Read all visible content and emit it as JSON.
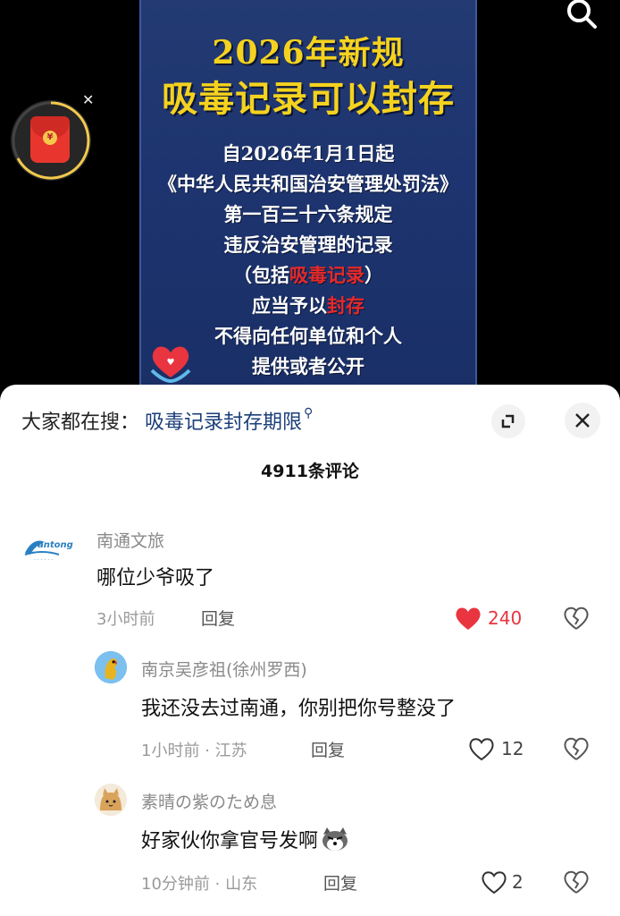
{
  "video": {
    "title_line1": "2026年新规",
    "title_line2": "吸毒记录可以封存",
    "lines": [
      {
        "parts": [
          {
            "text": "自2026年1月1日起",
            "red": false
          }
        ]
      },
      {
        "parts": [
          {
            "text": "《中华人民共和国治安管理处罚法》",
            "red": false
          }
        ]
      },
      {
        "parts": [
          {
            "text": "第一百三十六条规定",
            "red": false
          }
        ]
      },
      {
        "parts": [
          {
            "text": "违反治安管理的记录",
            "red": false
          }
        ]
      },
      {
        "parts": [
          {
            "text": "（包括",
            "red": false
          },
          {
            "text": "吸毒记录",
            "red": true
          },
          {
            "text": "）",
            "red": false
          }
        ]
      },
      {
        "parts": [
          {
            "text": "应当予以",
            "red": false
          },
          {
            "text": "封存",
            "red": true
          }
        ]
      },
      {
        "parts": [
          {
            "text": "不得向任何单位和个人",
            "red": false
          }
        ]
      },
      {
        "parts": [
          {
            "text": "提供或者公开",
            "red": false
          }
        ]
      }
    ],
    "icons": {
      "search": "search-icon",
      "red_packet": "red-packet-icon",
      "close": "close-icon",
      "logo": "heart-hands-logo"
    },
    "colors": {
      "title": "#f5d21e",
      "highlight": "#e52a2a",
      "poster_bg": "#1d3470"
    }
  },
  "sheet": {
    "search_prefix": "大家都在搜：",
    "search_keyword": "吸毒记录封存期限",
    "comment_count": "4911条评论",
    "expand_icon": "expand-icon",
    "close_icon": "close-icon"
  },
  "comments": [
    {
      "user": "南通文旅",
      "text": "哪位少爷吸了",
      "time": "3小时前",
      "location": "",
      "reply": "回复",
      "likes": "240",
      "liked": true,
      "avatar": "nantong-logo-avatar"
    },
    {
      "user": "南京吴彦祖(徐州罗西)",
      "text": "我还没去过南通，你别把你号整没了",
      "time": "1小时前",
      "location": "江苏",
      "reply": "回复",
      "likes": "12",
      "liked": false,
      "avatar": "parrot-avatar"
    },
    {
      "user": "素晴の紫のため息",
      "text": "好家伙你拿官号发啊",
      "time": "10分钟前",
      "location": "山东",
      "reply": "回复",
      "likes": "2",
      "liked": false,
      "avatar": "cat-avatar"
    }
  ],
  "colors": {
    "like_red": "#e8353f",
    "keyword_blue": "#1b3e7a"
  }
}
